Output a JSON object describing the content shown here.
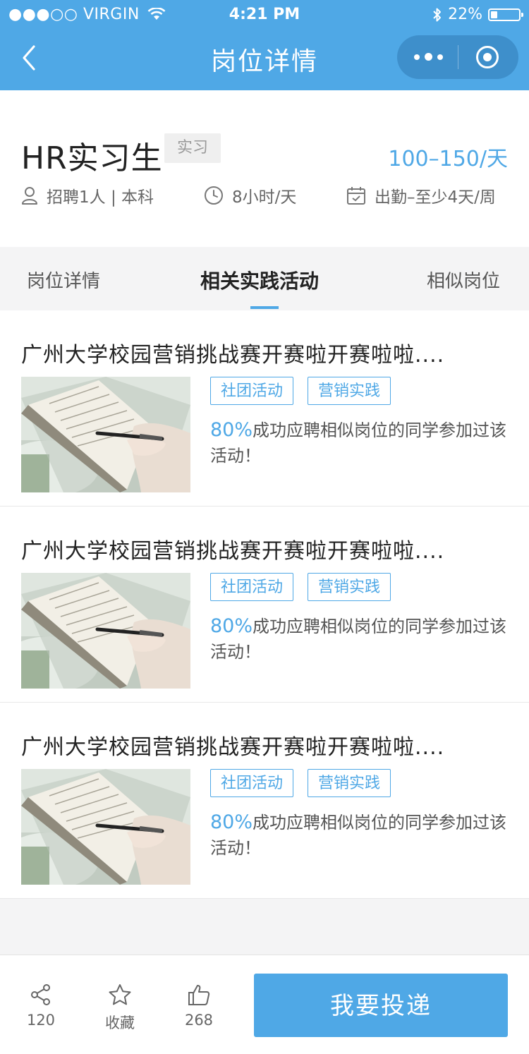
{
  "status": {
    "carrier": "●●●○○ VIRGIN",
    "time": "4:21 PM",
    "battery": "22%"
  },
  "nav": {
    "title": "岗位详情"
  },
  "job": {
    "title": "HR实习生",
    "tag": "实习",
    "salary": "100–150/天",
    "meta": {
      "recruit": "招聘1人 | 本科",
      "hours": "8小时/天",
      "attendance": "出勤–至少4天/周"
    }
  },
  "tabs": [
    {
      "label": "岗位详情"
    },
    {
      "label": "相关实践活动",
      "active": true
    },
    {
      "label": "相似岗位"
    }
  ],
  "activities": [
    {
      "title": "广州大学校园营销挑战赛开赛啦开赛啦啦....",
      "tags": [
        "社团活动",
        "营销实践"
      ],
      "percent": "80%",
      "desc": "成功应聘相似岗位的同学参加过该活动！"
    },
    {
      "title": "广州大学校园营销挑战赛开赛啦开赛啦啦....",
      "tags": [
        "社团活动",
        "营销实践"
      ],
      "percent": "80%",
      "desc": "成功应聘相似岗位的同学参加过该活动！"
    },
    {
      "title": "广州大学校园营销挑战赛开赛啦开赛啦啦....",
      "tags": [
        "社团活动",
        "营销实践"
      ],
      "percent": "80%",
      "desc": "成功应聘相似岗位的同学参加过该活动！"
    }
  ],
  "bottom": {
    "share_count": "120",
    "favorite_label": "收藏",
    "like_count": "268",
    "apply_label": "我要投递"
  },
  "colors": {
    "accent": "#4fa8e6",
    "capsule": "#3e8fcb"
  },
  "icons": [
    "wifi-icon",
    "bluetooth-icon",
    "battery-icon",
    "back-arrow-icon",
    "more-icon",
    "target-icon",
    "person-icon",
    "clock-icon",
    "calendar-icon",
    "share-icon",
    "star-icon",
    "thumbs-up-icon"
  ]
}
